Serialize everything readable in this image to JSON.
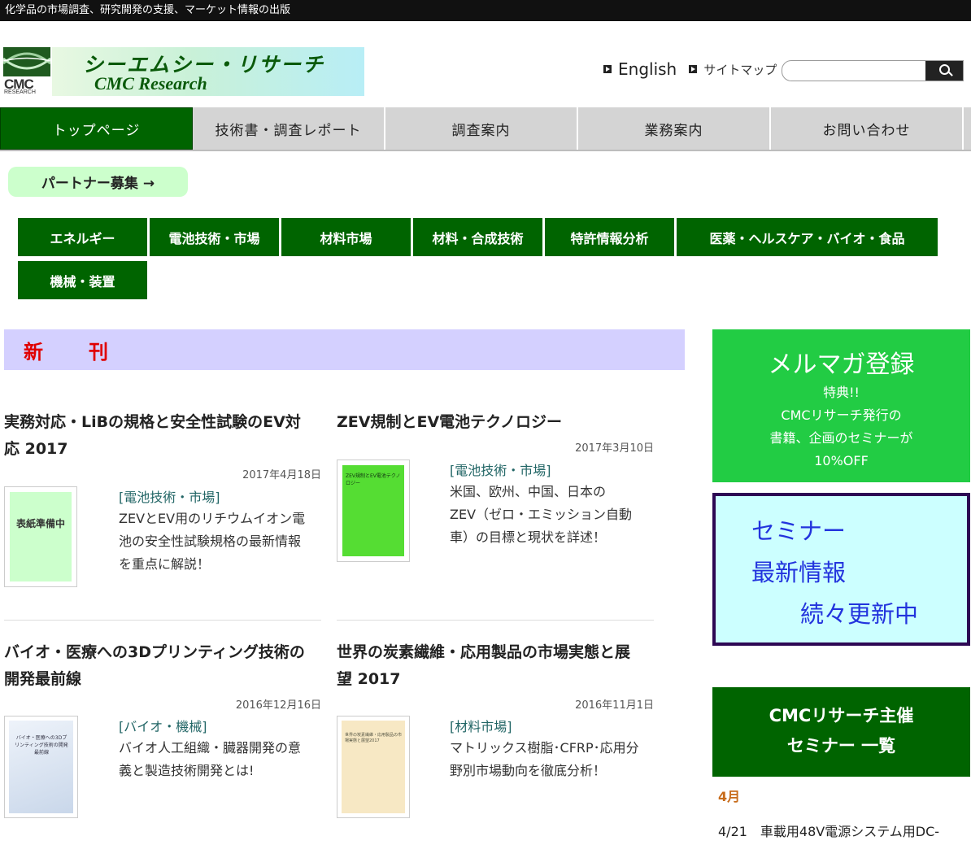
{
  "topbar": {
    "tagline": "化学品の市場調査、研究開発の支援、マーケット情報の出版"
  },
  "logo": {
    "mark": "CMC",
    "mark_sub": "RESEARCH",
    "name_jp": "シーエムシー・リサーチ",
    "name_en": "CMC Research"
  },
  "header_links": {
    "english": "English",
    "sitemap": "サイトマップ"
  },
  "search": {
    "placeholder": "",
    "value": "",
    "icon": "search-icon"
  },
  "nav": {
    "tabs": [
      {
        "label": "トップページ"
      },
      {
        "label": "技術書・調査レポート"
      },
      {
        "label": "調査案内"
      },
      {
        "label": "業務案内"
      },
      {
        "label": "お問い合わせ"
      }
    ]
  },
  "partner": {
    "label": "パートナー募集 →"
  },
  "categories": [
    {
      "label": "エネルギー"
    },
    {
      "label": "電池技術・市場"
    },
    {
      "label": "材料市場"
    },
    {
      "label": "材料・合成技術"
    },
    {
      "label": "特許情報分析"
    },
    {
      "label": "医薬・ヘルスケア・バイオ・食品"
    },
    {
      "label": "機械・装置"
    }
  ],
  "section": {
    "title": "新　刊"
  },
  "books": [
    {
      "title_line1": "実務対応・LiBの規格と安全性試験のEV対",
      "title_line2": "応 2017",
      "date": "2017年4月18日",
      "category": "[電池技術・市場]",
      "desc": [
        "ZEVとEV用のリチウムイオン電",
        "池の安全性試験規格の最新情報",
        "を重点に解説！"
      ],
      "cover_text": "表紙準備中"
    },
    {
      "title_line1": "ZEV規制とEV電池テクノロジー",
      "title_line2": "",
      "date": "2017年3月10日",
      "category": "[電池技術・市場]",
      "desc": [
        "米国、欧州、中国、日本の",
        "ZEV（ゼロ・エミッション自動",
        "車）の目標と現状を詳述！"
      ],
      "cover_text": "ZEV規制とEV電池テクノロジー"
    },
    {
      "title_line1": "バイオ・医療への3Dプリンティング技術の",
      "title_line2": "開発最前線",
      "date": "2016年12月16日",
      "category": "[バイオ・機械]",
      "desc": [
        "バイオ人工組織・臓器開発の意",
        "義と製造技術開発とは!"
      ],
      "cover_text": "バイオ・医療への3Dプリンティング技術の開発最前線"
    },
    {
      "title_line1": "世界の炭素繊維・応用製品の市場実態と展",
      "title_line2": "望 2017",
      "date": "2016年11月1日",
      "category": "[材料市場]",
      "desc": [
        "マトリックス樹脂･CFRP･応用分",
        "野別市場動向を徹底分析！"
      ],
      "cover_text": "世界の炭素繊維・応用製品の市場実態と展望2017"
    }
  ],
  "mailmag": {
    "title": "メルマガ登録",
    "lines": [
      "特典!!",
      "CMCリサーチ発行の",
      "書籍、企画のセミナーが",
      "10%OFF"
    ]
  },
  "seminar": {
    "line1": "セミナー",
    "line2": "最新情報",
    "line3": "続々更新中"
  },
  "seminar_list": {
    "title_line1": "CMCリサーチ主催",
    "title_line2": "セミナー 一覧",
    "month": "4月",
    "event": "4/21　車載用48V電源システム用DC-"
  },
  "colors": {
    "nav_active": "#006400",
    "category_bg": "#006400",
    "section_bg": "#d4d0ff",
    "mail_bg": "#22cc44",
    "seminar_bg": "#ccffff"
  }
}
